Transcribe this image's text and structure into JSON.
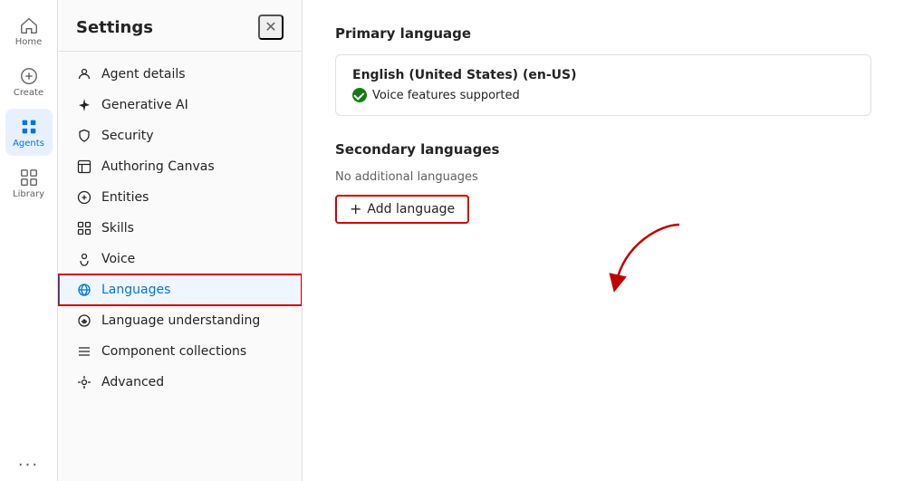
{
  "nav": {
    "items": [
      {
        "id": "home",
        "label": "Home",
        "active": false
      },
      {
        "id": "create",
        "label": "Create",
        "active": false
      },
      {
        "id": "agents",
        "label": "Agents",
        "active": true
      },
      {
        "id": "library",
        "label": "Library",
        "active": false
      }
    ],
    "more_label": "..."
  },
  "settings": {
    "title": "Settings",
    "close_label": "✕",
    "menu_items": [
      {
        "id": "agent-details",
        "label": "Agent details",
        "icon": "agent"
      },
      {
        "id": "generative-ai",
        "label": "Generative AI",
        "icon": "sparkle"
      },
      {
        "id": "security",
        "label": "Security",
        "icon": "shield"
      },
      {
        "id": "authoring-canvas",
        "label": "Authoring Canvas",
        "icon": "canvas"
      },
      {
        "id": "entities",
        "label": "Entities",
        "icon": "entities"
      },
      {
        "id": "skills",
        "label": "Skills",
        "icon": "skills"
      },
      {
        "id": "voice",
        "label": "Voice",
        "icon": "voice"
      },
      {
        "id": "languages",
        "label": "Languages",
        "icon": "languages",
        "active": true
      },
      {
        "id": "language-understanding",
        "label": "Language understanding",
        "icon": "understanding"
      },
      {
        "id": "component-collections",
        "label": "Component collections",
        "icon": "collections"
      },
      {
        "id": "advanced",
        "label": "Advanced",
        "icon": "advanced"
      }
    ]
  },
  "main": {
    "primary_language": {
      "section_title": "Primary language",
      "language_name": "English (United States) (en-US)",
      "voice_label": "Voice features supported"
    },
    "secondary_languages": {
      "section_title": "Secondary languages",
      "no_languages_label": "No additional languages",
      "add_button_label": "Add language"
    }
  }
}
